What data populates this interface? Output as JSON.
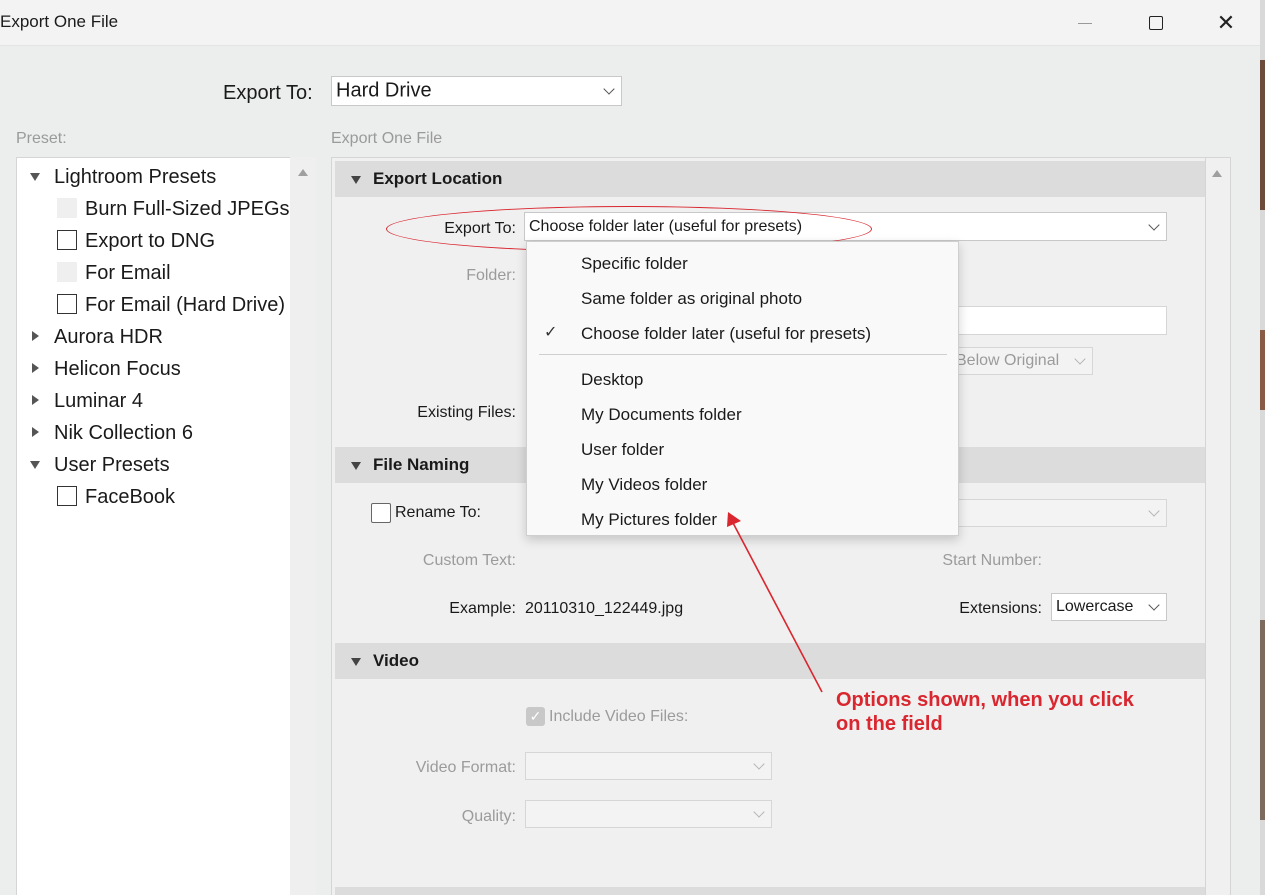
{
  "window": {
    "title": "Export One File",
    "minimize_icon": "minimize-icon",
    "maximize_icon": "maximize-icon",
    "close_icon": "close-icon"
  },
  "export_to": {
    "label": "Export To:",
    "value": "Hard Drive"
  },
  "preset": {
    "heading": "Preset:",
    "groups": [
      {
        "label": "Lightroom Presets",
        "expanded": true,
        "items": [
          {
            "label": "Burn Full-Sized JPEGs",
            "checkbox": "ghost"
          },
          {
            "label": "Export to DNG",
            "checkbox": "empty"
          },
          {
            "label": "For Email",
            "checkbox": "ghost"
          },
          {
            "label": "For Email (Hard Drive)",
            "checkbox": "empty"
          }
        ]
      },
      {
        "label": "Aurora HDR",
        "expanded": false
      },
      {
        "label": "Helicon Focus",
        "expanded": false
      },
      {
        "label": "Luminar 4",
        "expanded": false
      },
      {
        "label": "Nik Collection 6",
        "expanded": false
      },
      {
        "label": "User Presets",
        "expanded": true,
        "items": [
          {
            "label": "FaceBook",
            "checkbox": "empty"
          }
        ]
      }
    ]
  },
  "main": {
    "heading": "Export One File",
    "export_location": {
      "title": "Export Location",
      "export_to_label": "Export To:",
      "export_to_value": "Choose folder later (useful for presets)",
      "folder_label": "Folder:",
      "subfolder_partial": "Below Original",
      "existing_files_label": "Existing Files:"
    },
    "file_naming": {
      "title": "File Naming",
      "rename_label": "Rename To:",
      "custom_text_label": "Custom Text:",
      "start_number_label": "Start Number:",
      "example_label": "Example:",
      "example_value": "20110310_122449.jpg",
      "extensions_label": "Extensions:",
      "extensions_value": "Lowercase"
    },
    "video": {
      "title": "Video",
      "include_label": "Include Video Files:",
      "include_checked": true,
      "format_label": "Video Format:",
      "quality_label": "Quality:"
    }
  },
  "dropdown": {
    "items": [
      {
        "label": "Specific folder",
        "checked": false
      },
      {
        "label": "Same folder as original photo",
        "checked": false
      },
      {
        "label": "Choose folder later (useful for presets)",
        "checked": true
      },
      {
        "label": "Desktop",
        "checked": false
      },
      {
        "label": "My Documents folder",
        "checked": false
      },
      {
        "label": "User folder",
        "checked": false
      },
      {
        "label": "My Videos folder",
        "checked": false
      },
      {
        "label": "My Pictures folder",
        "checked": false
      }
    ],
    "check_glyph": "✓"
  },
  "annotation": {
    "line1": "Options shown, when you click",
    "line2": "on the field",
    "color": "#d9262f"
  }
}
